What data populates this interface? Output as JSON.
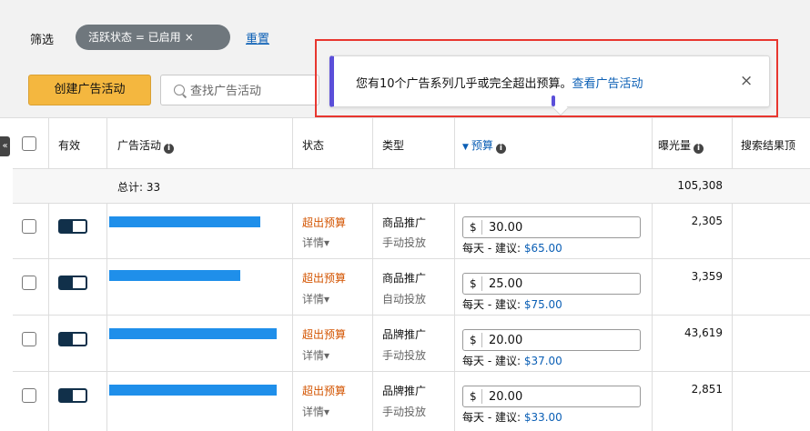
{
  "filter": {
    "label": "筛选",
    "chip_label": "活跃状态 = 已启用",
    "chip_close": "×",
    "reset_label": "重置"
  },
  "toolbar": {
    "create_label": "创建广告活动",
    "search_placeholder": "查找广告活动"
  },
  "toast": {
    "message": "您有10个广告系列几乎或完全超出预算。",
    "link_label": "查看广告活动",
    "close": "×",
    "accent_color": "#5b4fd9",
    "highlight_color": "#e8362f"
  },
  "collapse_label": "«",
  "table": {
    "headers": {
      "active": "有效",
      "campaign": "广告活动",
      "status": "状态",
      "type": "类型",
      "budget": "预算",
      "impressions": "曝光量",
      "search_top": "搜索结果顶"
    },
    "total_label": "总计: 33",
    "total_impressions": "105,308",
    "rows": [
      {
        "status": "超出预算",
        "detail": "详情▾",
        "type": "商品推广",
        "targeting": "手动投放",
        "currency": "$",
        "budget": "30.00",
        "suggest_prefix": "每天 - 建议: ",
        "suggest_value": "$65.00",
        "impressions": "2,305"
      },
      {
        "status": "超出预算",
        "detail": "详情▾",
        "type": "商品推广",
        "targeting": "自动投放",
        "currency": "$",
        "budget": "25.00",
        "suggest_prefix": "每天 - 建议: ",
        "suggest_value": "$75.00",
        "impressions": "3,359"
      },
      {
        "status": "超出预算",
        "detail": "详情▾",
        "type": "品牌推广",
        "targeting": "手动投放",
        "currency": "$",
        "budget": "20.00",
        "suggest_prefix": "每天 - 建议: ",
        "suggest_value": "$37.00",
        "impressions": "43,619"
      },
      {
        "status": "超出预算",
        "detail": "详情▾",
        "type": "品牌推广",
        "targeting": "手动投放",
        "currency": "$",
        "budget": "20.00",
        "suggest_prefix": "每天 - 建议: ",
        "suggest_value": "$33.00",
        "impressions": "2,851"
      }
    ]
  },
  "colors": {
    "primary_button": "#f4b73f",
    "link": "#0b5fb5",
    "over_budget": "#d35400",
    "redaction": "#1f8fea"
  }
}
